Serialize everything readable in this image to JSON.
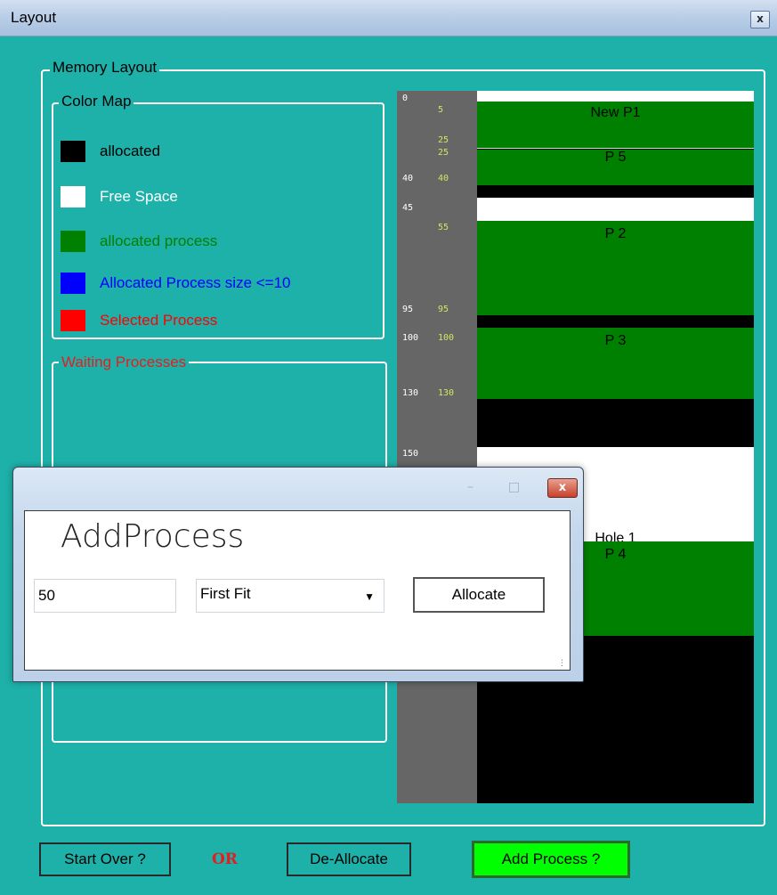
{
  "window": {
    "title": "Layout",
    "close_glyph": "x"
  },
  "groups": {
    "memory_layout": "Memory Layout",
    "color_map": "Color Map",
    "waiting": "Waiting Processes"
  },
  "legend": [
    {
      "label": "allocated",
      "color": "#000000",
      "text_color": "#000000"
    },
    {
      "label": "Free Space",
      "color": "#ffffff",
      "text_color": "#ffffff"
    },
    {
      "label": "allocated process",
      "color": "#008000",
      "text_color": "#008000"
    },
    {
      "label": "Allocated Process size <=10",
      "color": "#0000ff",
      "text_color": "#0000ff"
    },
    {
      "label": "Selected Process",
      "color": "#ff0000",
      "text_color": "#ff0000"
    }
  ],
  "ruler_white": [
    "0",
    "40",
    "45",
    "95",
    "100",
    "130",
    "150"
  ],
  "ruler_green": [
    "5",
    "25",
    "25",
    "40",
    "55",
    "95",
    "100",
    "130"
  ],
  "blocks": [
    {
      "label": "New P1",
      "color": "#008000"
    },
    {
      "label": "P 5",
      "color": "#008000"
    },
    {
      "label": "P 2",
      "color": "#008000"
    },
    {
      "label": "P 3",
      "color": "#008000"
    },
    {
      "label": "Hole 1",
      "color": "#ffffff"
    },
    {
      "label": "P 4",
      "color": "#008000"
    }
  ],
  "buttons": {
    "start_over": "Start Over ?",
    "or": "OR",
    "deallocate": "De-Allocate",
    "add_process": "Add Process ?"
  },
  "dialog": {
    "title": "AddProcess",
    "size_value": "50",
    "fit_selected": "First Fit",
    "allocate": "Allocate",
    "close_glyph": "x"
  }
}
